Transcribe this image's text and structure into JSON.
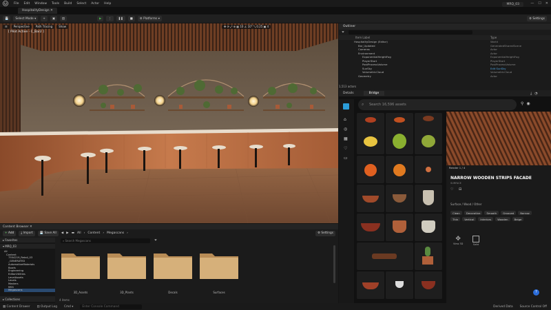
{
  "menubar": {
    "items": [
      "File",
      "Edit",
      "Window",
      "Tools",
      "Build",
      "Select",
      "Actor",
      "Help"
    ],
    "project": "MRQ_03"
  },
  "tab": {
    "label": "HospitalityDesign"
  },
  "toolbar": {
    "select_mode": "Select Mode",
    "platforms": "Platforms",
    "settings": "Settings"
  },
  "viewport": {
    "perspective": "Perspective",
    "path_tracing": "Path Tracing",
    "show": "Show",
    "pilot": "[ Pilot Active - C_Bar2 ]"
  },
  "outliner": {
    "title": "Outliner",
    "columns": [
      "Item Label",
      "Type"
    ],
    "rows": [
      {
        "label": "HospitalityDesign (Editor)",
        "type": "World"
      },
      {
        "label": "Bar_Updated",
        "type": "GeneratedSharedScene"
      },
      {
        "label": "Cameras",
        "type": "Actor"
      },
      {
        "label": "Environment",
        "type": "Actor"
      },
      {
        "label": "ExponentialHeightFog",
        "type": "ExponentialHeightFog"
      },
      {
        "label": "PlayerStart",
        "type": "PlayerStart"
      },
      {
        "label": "PostProcessVolume",
        "type": "PostProcessVolume"
      },
      {
        "label": "SunSky",
        "type": "Edit SunSky"
      },
      {
        "label": "VolumetricCloud",
        "type": "VolumetricCloud"
      },
      {
        "label": "Geometry",
        "type": "Actor"
      }
    ],
    "status": "1,513 actors"
  },
  "bridge": {
    "tabs": [
      "Details",
      "Bridge"
    ],
    "search_placeholder": "Search 16,596 assets"
  },
  "detail": {
    "render_label": "Render 1 / 4",
    "title": "NARROW WOODEN STRIPS FACADE",
    "subtitle": "SURFACE",
    "category": "Surface  /  Wood  /  Other",
    "tags": [
      "Clean",
      "Decorative",
      "Smooth",
      "Grooved",
      "Narrow",
      "Thin",
      "Vertical",
      "Interiors",
      "Wooden",
      "Beige"
    ],
    "view_btn": "View 3D",
    "solid_btn": "Solid"
  },
  "content_browser": {
    "title": "Content Browser",
    "add": "Add",
    "import": "Import",
    "save_all": "Save All",
    "breadcrumb": [
      "All",
      "Content",
      "Megascans"
    ],
    "settings": "Settings",
    "search_placeholder": "Search Megascans",
    "favorites": "Favorites",
    "root": "MRQ_03",
    "tree": [
      "All",
      "Content",
      "7554219_Retail_03",
      "_GENERATED",
      "AutomotiveMaterials",
      "Bowls",
      "Engineering",
      "EditorUtilities",
      "LevelAssets",
      "Levels",
      "Masters",
      "MSS",
      "Megascans"
    ],
    "folders": [
      "3D_Assets",
      "3D_Plants",
      "Decals",
      "Surfaces"
    ],
    "item_count": "4 items",
    "collections": "Collections"
  },
  "statusbar": {
    "items": [
      "Content Drawer",
      "Output Log",
      "Cmd"
    ],
    "cmd_placeholder": "Enter Console Command",
    "right": [
      "Derived Data",
      "Source Control Off"
    ]
  },
  "colors": {
    "accent": "#0078d4",
    "panel": "#1b1b1b",
    "folder": "#d6b07a",
    "play": "#46b04a"
  }
}
